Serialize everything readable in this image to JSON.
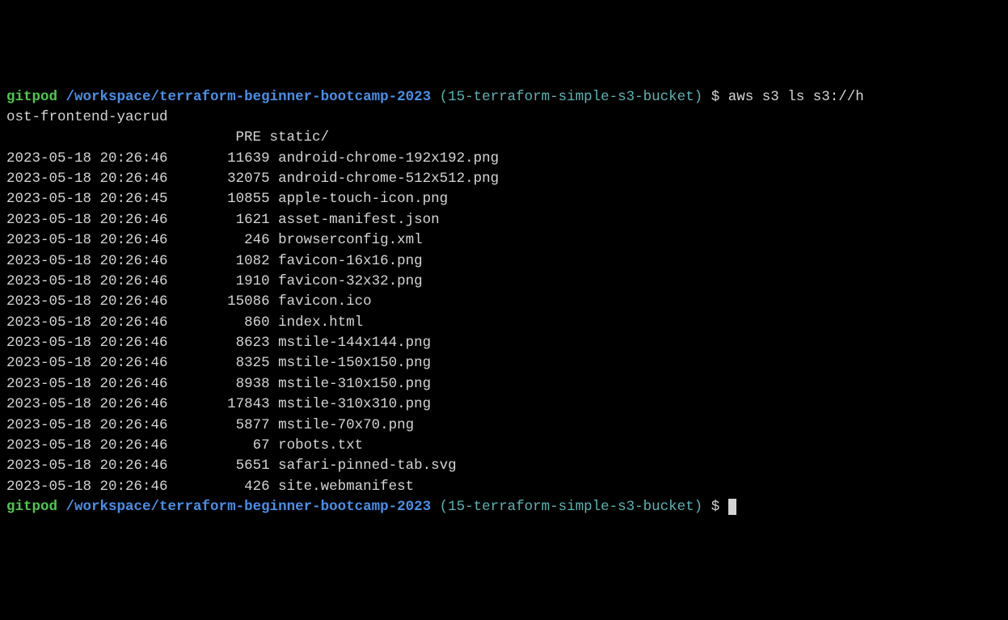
{
  "prompt1": {
    "user": "gitpod",
    "path": "/workspace/terraform-beginner-bootcamp-2023",
    "branch": "(15-terraform-simple-s3-bucket)",
    "dollar": "$",
    "command": "aws s3 ls s3://h"
  },
  "cmd_wrap": "ost-frontend-yacrud",
  "prefix_line": "                           PRE static/",
  "files": [
    {
      "dt": "2023-05-18 20:26:46",
      "sz": "      11639",
      "name": "android-chrome-192x192.png"
    },
    {
      "dt": "2023-05-18 20:26:46",
      "sz": "      32075",
      "name": "android-chrome-512x512.png"
    },
    {
      "dt": "2023-05-18 20:26:45",
      "sz": "      10855",
      "name": "apple-touch-icon.png"
    },
    {
      "dt": "2023-05-18 20:26:46",
      "sz": "       1621",
      "name": "asset-manifest.json"
    },
    {
      "dt": "2023-05-18 20:26:46",
      "sz": "        246",
      "name": "browserconfig.xml"
    },
    {
      "dt": "2023-05-18 20:26:46",
      "sz": "       1082",
      "name": "favicon-16x16.png"
    },
    {
      "dt": "2023-05-18 20:26:46",
      "sz": "       1910",
      "name": "favicon-32x32.png"
    },
    {
      "dt": "2023-05-18 20:26:46",
      "sz": "      15086",
      "name": "favicon.ico"
    },
    {
      "dt": "2023-05-18 20:26:46",
      "sz": "        860",
      "name": "index.html"
    },
    {
      "dt": "2023-05-18 20:26:46",
      "sz": "       8623",
      "name": "mstile-144x144.png"
    },
    {
      "dt": "2023-05-18 20:26:46",
      "sz": "       8325",
      "name": "mstile-150x150.png"
    },
    {
      "dt": "2023-05-18 20:26:46",
      "sz": "       8938",
      "name": "mstile-310x150.png"
    },
    {
      "dt": "2023-05-18 20:26:46",
      "sz": "      17843",
      "name": "mstile-310x310.png"
    },
    {
      "dt": "2023-05-18 20:26:46",
      "sz": "       5877",
      "name": "mstile-70x70.png"
    },
    {
      "dt": "2023-05-18 20:26:46",
      "sz": "         67",
      "name": "robots.txt"
    },
    {
      "dt": "2023-05-18 20:26:46",
      "sz": "       5651",
      "name": "safari-pinned-tab.svg"
    },
    {
      "dt": "2023-05-18 20:26:46",
      "sz": "        426",
      "name": "site.webmanifest"
    }
  ],
  "prompt2": {
    "user": "gitpod",
    "path": "/workspace/terraform-beginner-bootcamp-2023",
    "branch": "(15-terraform-simple-s3-bucket)",
    "dollar": "$"
  }
}
